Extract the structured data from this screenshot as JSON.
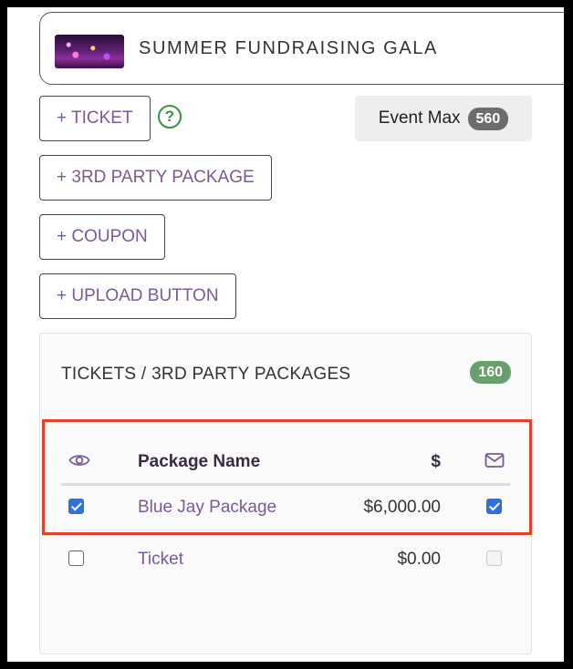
{
  "event": {
    "title": "SUMMER FUNDRAISING GALA",
    "thumbnail_icon": "event-photo"
  },
  "buttons": {
    "add_ticket": "+ TICKET",
    "add_3rd_party_package": "+ 3RD PARTY PACKAGE",
    "add_coupon": "+ COUPON",
    "upload_button": "+ UPLOAD BUTTON",
    "help_icon": "?"
  },
  "event_max": {
    "label": "Event Max",
    "value": "560"
  },
  "panel": {
    "title": "TICKETS / 3RD PARTY PACKAGES",
    "count": "160",
    "columns": {
      "visibility_icon": "eye-icon",
      "name": "Package Name",
      "price": "$",
      "email_icon": "mail-icon"
    },
    "rows": [
      {
        "visible": true,
        "name": "Blue Jay Package",
        "price": "$6,000.00",
        "email": true,
        "email_enabled": true,
        "highlighted": true
      },
      {
        "visible": false,
        "name": "Ticket",
        "price": "$0.00",
        "email": false,
        "email_enabled": false,
        "highlighted": false
      }
    ]
  },
  "colors": {
    "accent_purple": "#7a5a93",
    "help_green": "#3e8e41",
    "count_green": "#6a9e6a",
    "max_gray": "#6c6c6c",
    "highlight_red": "#e0422c",
    "checkbox_blue": "#2f6fe0"
  }
}
